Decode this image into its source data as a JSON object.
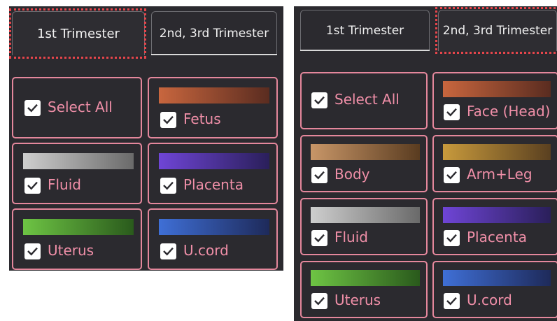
{
  "left": {
    "tabs": [
      "1st Trimester",
      "2nd, 3rd Trimester"
    ],
    "items": [
      {
        "label": "Select All",
        "checked": true
      },
      {
        "label": "Fetus",
        "checked": true,
        "gradient": [
          "#c8663e",
          "#5a2c20"
        ]
      },
      {
        "label": "Fluid",
        "checked": true,
        "gradient": [
          "#cecece",
          "#6a6a6a"
        ]
      },
      {
        "label": "Placenta",
        "checked": true,
        "gradient": [
          "#6f45d6",
          "#2a1f5a"
        ]
      },
      {
        "label": "Uterus",
        "checked": true,
        "gradient": [
          "#6ec444",
          "#2a5a1c"
        ]
      },
      {
        "label": "U.cord",
        "checked": true,
        "gradient": [
          "#3f6fd6",
          "#1e2a5a"
        ]
      }
    ]
  },
  "right": {
    "tabs": [
      "1st Trimester",
      "2nd, 3rd Trimester"
    ],
    "items": [
      {
        "label": "Select All",
        "checked": true
      },
      {
        "label": "Face (Head)",
        "checked": true,
        "gradient": [
          "#c8663e",
          "#5a2c20"
        ]
      },
      {
        "label": "Body",
        "checked": true,
        "gradient": [
          "#c89668",
          "#5a3c20"
        ]
      },
      {
        "label": "Arm+Leg",
        "checked": true,
        "gradient": [
          "#c89a3c",
          "#5a4020"
        ]
      },
      {
        "label": "Fluid",
        "checked": true,
        "gradient": [
          "#cecece",
          "#6a6a6a"
        ]
      },
      {
        "label": "Placenta",
        "checked": true,
        "gradient": [
          "#6f45d6",
          "#2a1f5a"
        ]
      },
      {
        "label": "Uterus",
        "checked": true,
        "gradient": [
          "#6ec444",
          "#2a5a1c"
        ]
      },
      {
        "label": "U.cord",
        "checked": true,
        "gradient": [
          "#3f6fd6",
          "#1e2a5a"
        ]
      }
    ]
  },
  "colors": {
    "panel_bg": "#2b2a2f",
    "card_border": "#e4879c",
    "label": "#f08fa8",
    "focus_dots": "#e5454b"
  }
}
